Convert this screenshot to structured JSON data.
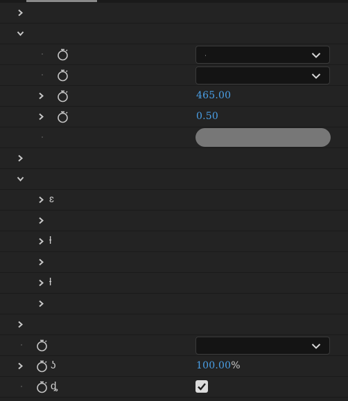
{
  "rows": [
    {
      "type": "group",
      "expanded": false,
      "level": 0
    },
    {
      "type": "group",
      "expanded": true,
      "level": 0
    },
    {
      "type": "param",
      "level": 1,
      "control": "dropdown",
      "value": "ˌ"
    },
    {
      "type": "param",
      "level": 1,
      "control": "dropdown",
      "value": ""
    },
    {
      "type": "param",
      "level": 1,
      "expandable": true,
      "control": "number",
      "value": "465.00"
    },
    {
      "type": "param",
      "level": 1,
      "expandable": true,
      "control": "number",
      "value": "0.50"
    },
    {
      "type": "param",
      "level": 1,
      "noStopwatch": true,
      "control": "slider"
    },
    {
      "type": "group",
      "expanded": false,
      "level": 0
    },
    {
      "type": "group",
      "expanded": true,
      "level": 0
    },
    {
      "type": "sub",
      "level": 1,
      "label": "ɛ"
    },
    {
      "type": "sub",
      "level": 1,
      "label": ""
    },
    {
      "type": "sub",
      "level": 1,
      "label": "ƚ"
    },
    {
      "type": "sub",
      "level": 1,
      "label": ""
    },
    {
      "type": "sub",
      "level": 1,
      "label": "ƚ"
    },
    {
      "type": "sub",
      "level": 1,
      "label": ""
    },
    {
      "type": "group",
      "expanded": false,
      "level": 0
    },
    {
      "type": "param",
      "level": 0,
      "control": "dropdown",
      "value": ""
    },
    {
      "type": "param",
      "level": 0,
      "expandable": true,
      "label": "ʖ",
      "control": "number",
      "value": "100.00",
      "unit": "%"
    },
    {
      "type": "param",
      "level": 0,
      "label": "ȡ",
      "control": "checkbox",
      "checked": true
    }
  ],
  "colors": {
    "panel_bg": "#232323",
    "value_blue": "#4aa0e8",
    "slider_gray": "#777777"
  },
  "icons": {
    "collapsed": "chevron-right-icon",
    "expanded": "chevron-down-icon",
    "keyframe": "stopwatch-icon",
    "dropdown": "chevron-down-icon",
    "check": "checkmark-icon"
  }
}
